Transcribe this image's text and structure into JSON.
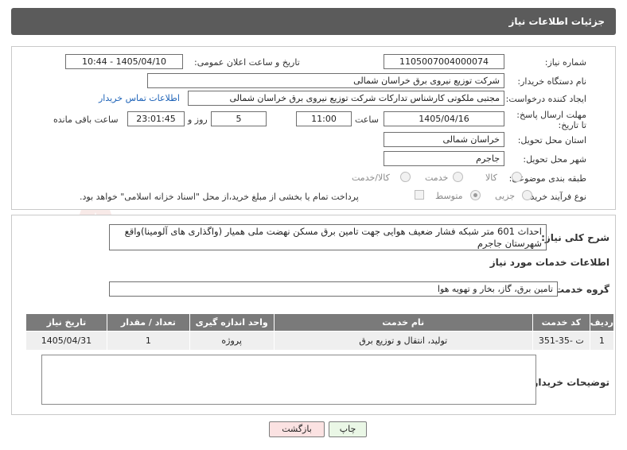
{
  "header": {
    "title": "جزئیات اطلاعات نیاز"
  },
  "form": {
    "need_number_label": "شماره نیاز:",
    "need_number": "1105007004000074",
    "announce_label": "تاریخ و ساعت اعلان عمومی:",
    "announce_value": "1405/04/10 - 10:44",
    "buyer_org_label": "نام دستگاه خریدار:",
    "buyer_org": "شرکت توزیع نیروی برق خراسان شمالی",
    "creator_label": "ایجاد کننده درخواست:",
    "creator": "مجتبی ملکوتی کارشناس تدارکات شرکت توزیع نیروی برق خراسان شمالی",
    "contact_link": "اطلاعات تماس خریدار",
    "deadline_label": "مهلت ارسال پاسخ: تا تاریخ:",
    "deadline_date": "1405/04/16",
    "time_label": "ساعت",
    "deadline_time": "11:00",
    "days_value": "5",
    "days_label": "روز و",
    "remaining_time": "23:01:45",
    "remaining_label": "ساعت باقی مانده",
    "province_label": "استان محل تحویل:",
    "province": "خراسان شمالی",
    "city_label": "شهر محل تحویل:",
    "city": "جاجرم",
    "category_label": "طبقه بندی موضوعی:",
    "category_options": [
      "کالا",
      "خدمت",
      "کالا/خدمت"
    ],
    "category_selected": "خدمت",
    "process_label": "نوع فرآیند خرید :",
    "process_options": [
      "جزیی",
      "متوسط"
    ],
    "process_selected": "متوسط",
    "payment_note": "پرداخت تمام یا بخشی از مبلغ خرید،از محل \"اسناد خزانه اسلامی\" خواهد بود."
  },
  "details": {
    "summary_label": "شرح کلی نیاز:",
    "summary": "احداث 601 متر شبکه فشار ضعیف هوایی جهت تامین برق مسکن نهضت ملی همیار (واگذاری های آلومینا)واقع شهرستان جاجرم",
    "services_heading": "اطلاعات خدمات مورد نیاز",
    "service_group_label": "گروه خدمت:",
    "service_group": "تامین برق، گاز، بخار و تهویه هوا",
    "table_headers": [
      "ردیف",
      "کد خدمت",
      "نام خدمت",
      "واحد اندازه گیری",
      "تعداد / مقدار",
      "تاریخ نیاز"
    ],
    "table_rows": [
      [
        "1",
        "ت -35-351",
        "تولید، انتقال و توزیع برق",
        "پروژه",
        "1",
        "1405/04/31"
      ]
    ],
    "buyer_notes_label": "توضیحات خریدار:",
    "buyer_notes": ""
  },
  "buttons": {
    "print": "چاپ",
    "back": "بازگشت"
  },
  "watermark_text": "AriaTender.net"
}
